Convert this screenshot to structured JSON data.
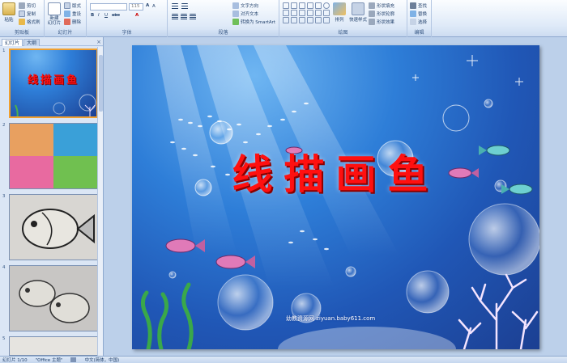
{
  "ribbon": {
    "clipboard": {
      "paste": "粘贴",
      "cut": "剪切",
      "copy": "复制",
      "format_painter": "格式刷",
      "label": "剪贴板"
    },
    "slides": {
      "new_slide": "新建\n幻灯片",
      "layout": "版式",
      "reset": "重设",
      "delete": "删除",
      "label": "幻灯片"
    },
    "font": {
      "size": "115",
      "label": "字体"
    },
    "paragraph": {
      "text_direction": "文字方向",
      "align_text": "对齐文本",
      "smartart": "转换为 SmartArt",
      "label": "段落"
    },
    "drawing": {
      "arrange": "排列",
      "quick_styles": "快速样式",
      "shape_fill": "形状填充",
      "shape_outline": "形状轮廓",
      "shape_effects": "形状效果",
      "label": "绘图"
    },
    "editing": {
      "find": "查找",
      "replace": "替换",
      "select": "选择",
      "label": "编辑"
    }
  },
  "panel": {
    "tab_slides": "幻灯片",
    "tab_outline": "大纲",
    "close": "×",
    "thumbnails": [
      {
        "num": "1",
        "title": "线描画鱼"
      },
      {
        "num": "2"
      },
      {
        "num": "3"
      },
      {
        "num": "4"
      },
      {
        "num": "5"
      }
    ]
  },
  "slide": {
    "title": "线描画鱼",
    "watermark": "幼教资源网 ziyuan.baby611.com"
  },
  "status": {
    "slide_of": "幻灯片 1/10",
    "theme": "\"Office 主题\"",
    "lang": "中文(简体，中国)"
  },
  "colors": {
    "title": "#ff1010",
    "selection": "#f0a030",
    "ribbon_border": "#8fa9cf"
  }
}
